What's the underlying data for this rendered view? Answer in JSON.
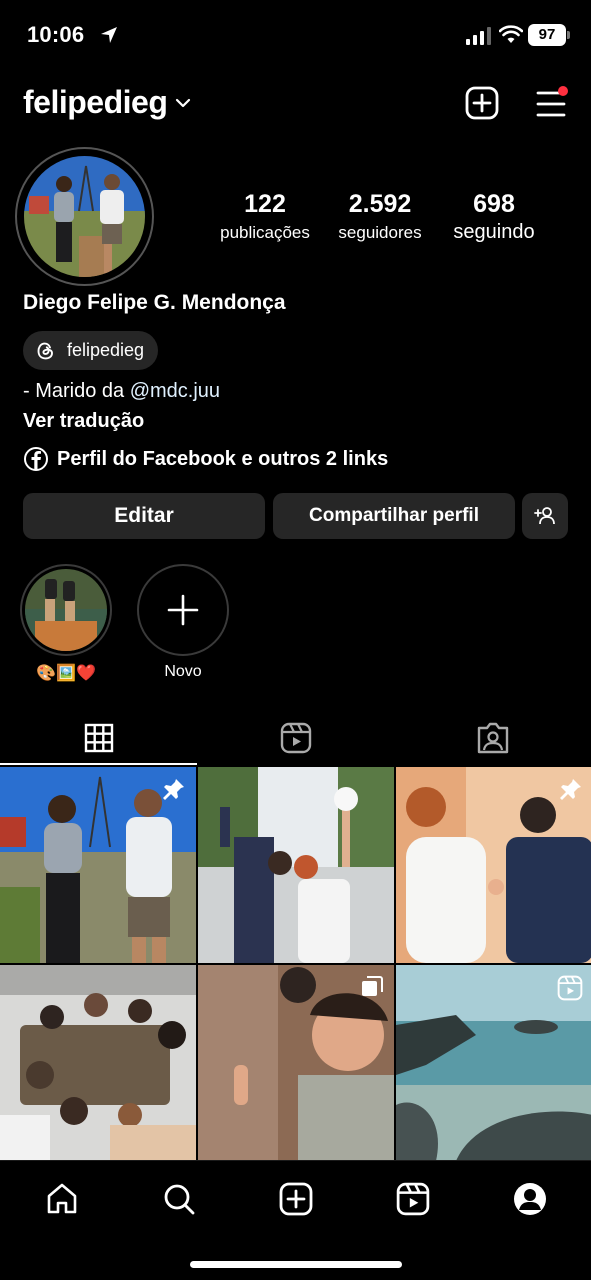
{
  "status_bar": {
    "time": "10:06",
    "battery": "97",
    "icons": [
      "location-arrow-icon",
      "signal-bars-icon",
      "wifi-icon"
    ]
  },
  "header": {
    "username": "felipedieg",
    "icons": [
      "chevron-down-icon",
      "create-post-icon",
      "menu-icon"
    ],
    "has_notification": true
  },
  "profile": {
    "stats": [
      {
        "value": "122",
        "label": "publicações"
      },
      {
        "value": "2.592",
        "label": "seguidores"
      },
      {
        "value": "698",
        "label": "seguindo"
      }
    ],
    "full_name": "Diego Felipe G. Mendonça",
    "threads_handle": "felipedieg",
    "bio_prefix": "- Marido da ",
    "bio_mention": "@mdc.juu",
    "translate_label": "Ver tradução",
    "links_label": "Perfil do Facebook e outros 2 links"
  },
  "actions": {
    "edit": "Editar",
    "share": "Compartilhar perfil",
    "discover_icon": "add-person-icon"
  },
  "highlights": [
    {
      "label": "🎨🖼️❤️"
    },
    {
      "label": "Novo"
    }
  ],
  "tabs": [
    "grid-icon",
    "reels-icon",
    "tagged-icon"
  ],
  "grid_badges": [
    "pin-icon",
    "",
    "pin-icon",
    "",
    "carousel-icon",
    "reel-icon"
  ],
  "bottom_nav": [
    "home-icon",
    "search-icon",
    "create-icon",
    "reels-icon",
    "profile-icon"
  ],
  "colors": {
    "background": "#000000",
    "button": "#262626",
    "notification": "#ff3040",
    "mention": "#e0f1ff"
  }
}
